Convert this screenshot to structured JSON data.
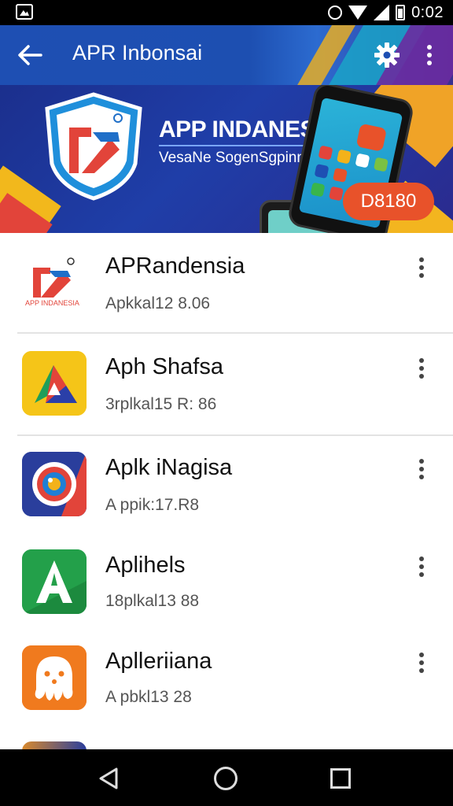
{
  "status_bar": {
    "time": "0:02",
    "icons": [
      "screenshot-icon",
      "alarm-icon",
      "wifi-icon",
      "signal-icon",
      "battery-icon"
    ]
  },
  "app_bar": {
    "title": "APR Inbonsai",
    "back_icon": "arrow-left-icon",
    "settings_icon": "gear-icon",
    "more_icon": "more-vert-icon",
    "colors": {
      "primary": "#1e4fb3",
      "accent_teal": "#1aa3c8",
      "accent_purple": "#6a2ba0",
      "accent_yellow": "#f3b21a"
    }
  },
  "banner": {
    "title": "APP INDANESIA",
    "subtitle": "VesaNe SogenSgpinn",
    "badge": "D8180",
    "colors": {
      "background": "#1f3ea8",
      "badge": "#e8522a",
      "yellow": "#f2b81c",
      "red": "#e2443a"
    }
  },
  "apps": [
    {
      "title": "APRandensia",
      "subtitle": "Apkkal12 8.06",
      "icon": "apr-logo-icon",
      "icon_caption": "APP INDANESIA",
      "more_icon": "more-vert-icon"
    },
    {
      "title": "Aph Shafsa",
      "subtitle": "3rplkal15 R: 86",
      "icon": "triangle-logo-icon",
      "more_icon": "more-vert-icon"
    },
    {
      "title": "Aplk iNagisa",
      "subtitle": "A ppik:17.R8",
      "icon": "camera-lens-icon",
      "more_icon": "more-vert-icon"
    },
    {
      "title": "Aplihels",
      "subtitle": "18plkal13 88",
      "icon": "letter-a-icon",
      "more_icon": "more-vert-icon"
    },
    {
      "title": "Aplleriiana",
      "subtitle": "A pbkl13 28",
      "icon": "octopus-icon",
      "more_icon": "more-vert-icon"
    }
  ],
  "nav_bar": {
    "back_icon": "nav-back-triangle-icon",
    "home_icon": "nav-home-circle-icon",
    "recents_icon": "nav-recents-square-icon"
  }
}
